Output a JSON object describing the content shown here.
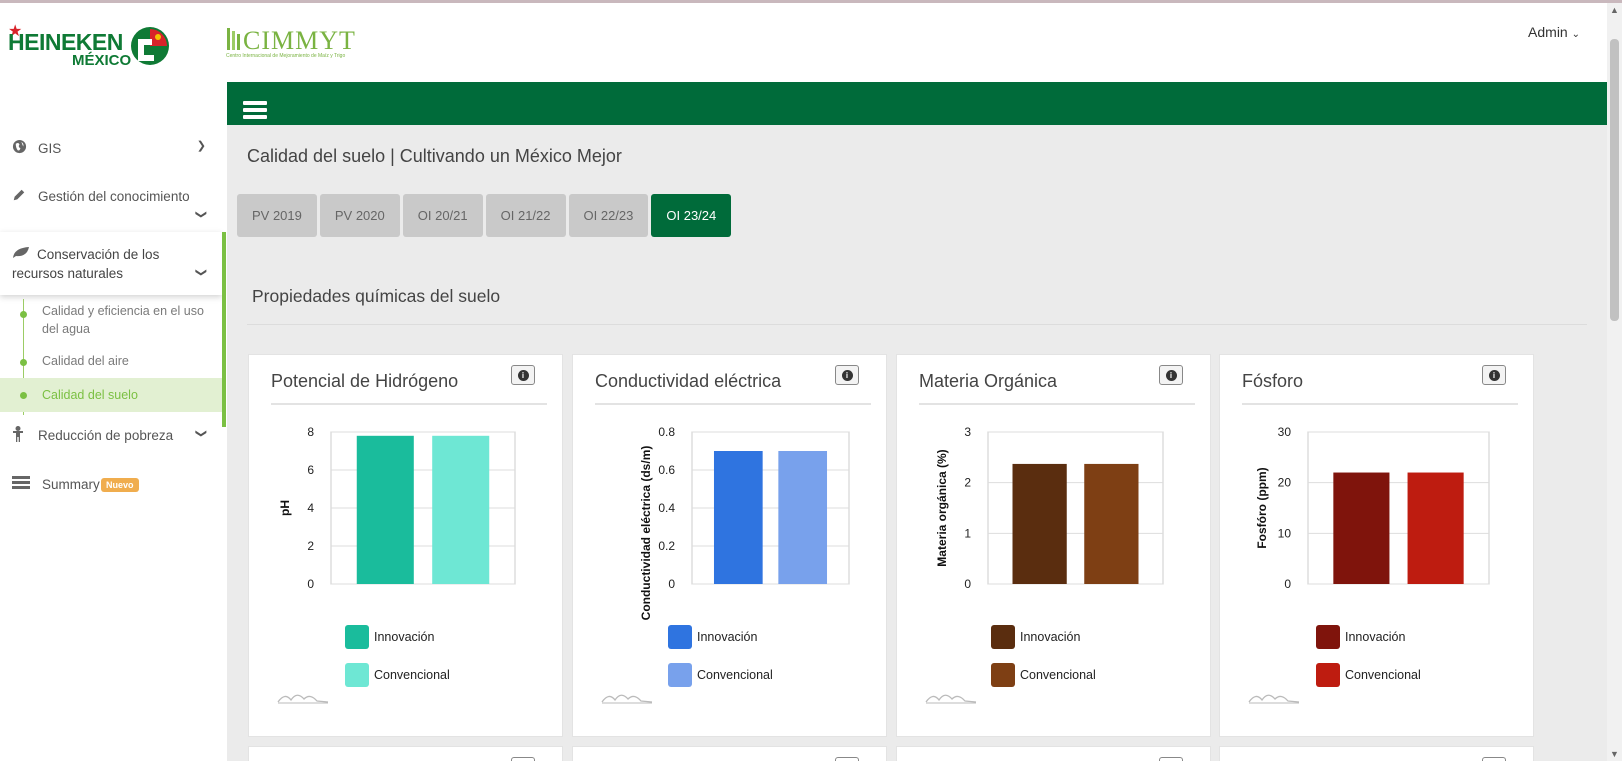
{
  "brand": {
    "heineken": "HEINEKEN",
    "heineken_sub": "MÉXICO",
    "cimmyt": "CIMMYT",
    "cimmyt_sub": "Centro Internacional de Mejoramiento de Maíz y Trigo"
  },
  "header": {
    "user": "Admin"
  },
  "sidebar": {
    "items": [
      {
        "label": "GIS",
        "icon": "globe-icon"
      },
      {
        "label": "Gestión del conocimiento",
        "icon": "pencil-icon"
      },
      {
        "label": "Conservación de los",
        "label2": "recursos naturales",
        "icon": "leaf-icon"
      },
      {
        "label": "Reducción de pobreza",
        "icon": "person-icon"
      },
      {
        "label": "Summary",
        "icon": "table-icon",
        "badge": "Nuevo"
      }
    ],
    "subitems": [
      {
        "label": "Calidad y eficiencia en el uso",
        "label2": "del agua"
      },
      {
        "label": "Calidad del aire"
      },
      {
        "label": "Calidad del suelo"
      }
    ]
  },
  "main": {
    "title": "Calidad del suelo | Cultivando un México Mejor",
    "tabs": [
      "PV 2019",
      "PV 2020",
      "OI 20/21",
      "OI 21/22",
      "OI 22/23",
      "OI 23/24"
    ],
    "active_tab": "OI 23/24",
    "section": "Propiedades químicas del suelo"
  },
  "chart_data": [
    {
      "type": "bar",
      "title": "Potencial de Hidrógeno",
      "ylabel": "pH",
      "ylim": [
        0,
        8
      ],
      "yticks": [
        "0",
        "2",
        "4",
        "6",
        "8"
      ],
      "series": [
        {
          "name": "Innovación",
          "values": [
            7.8
          ],
          "color": "#1abc9c"
        },
        {
          "name": "Convencional",
          "values": [
            7.8
          ],
          "color": "#6ee7d4"
        }
      ]
    },
    {
      "type": "bar",
      "title": "Conductividad eléctrica",
      "ylabel": "Conductividad eléctrica (ds/m)",
      "ylim": [
        0,
        0.8
      ],
      "yticks": [
        "0",
        "0.2",
        "0.4",
        "0.6",
        "0.8"
      ],
      "series": [
        {
          "name": "Innovación",
          "values": [
            0.7
          ],
          "color": "#2f74e0"
        },
        {
          "name": "Convencional",
          "values": [
            0.7
          ],
          "color": "#78a1ec"
        }
      ]
    },
    {
      "type": "bar",
      "title": "Materia Orgánica",
      "ylabel": "Materia orgánica (%)",
      "ylim": [
        0,
        3
      ],
      "yticks": [
        "0",
        "1",
        "2",
        "3"
      ],
      "series": [
        {
          "name": "Innovación",
          "values": [
            2.37
          ],
          "color": "#5a2d0f"
        },
        {
          "name": "Convencional",
          "values": [
            2.37
          ],
          "color": "#7e3f14"
        }
      ]
    },
    {
      "type": "bar",
      "title": "Fósforo",
      "ylabel": "Fosfóro (ppm)",
      "ylim": [
        0,
        30
      ],
      "yticks": [
        "0",
        "10",
        "20",
        "30"
      ],
      "series": [
        {
          "name": "Innovación",
          "values": [
            22
          ],
          "color": "#7f140c"
        },
        {
          "name": "Convencional",
          "values": [
            22
          ],
          "color": "#be1c10"
        }
      ]
    }
  ]
}
